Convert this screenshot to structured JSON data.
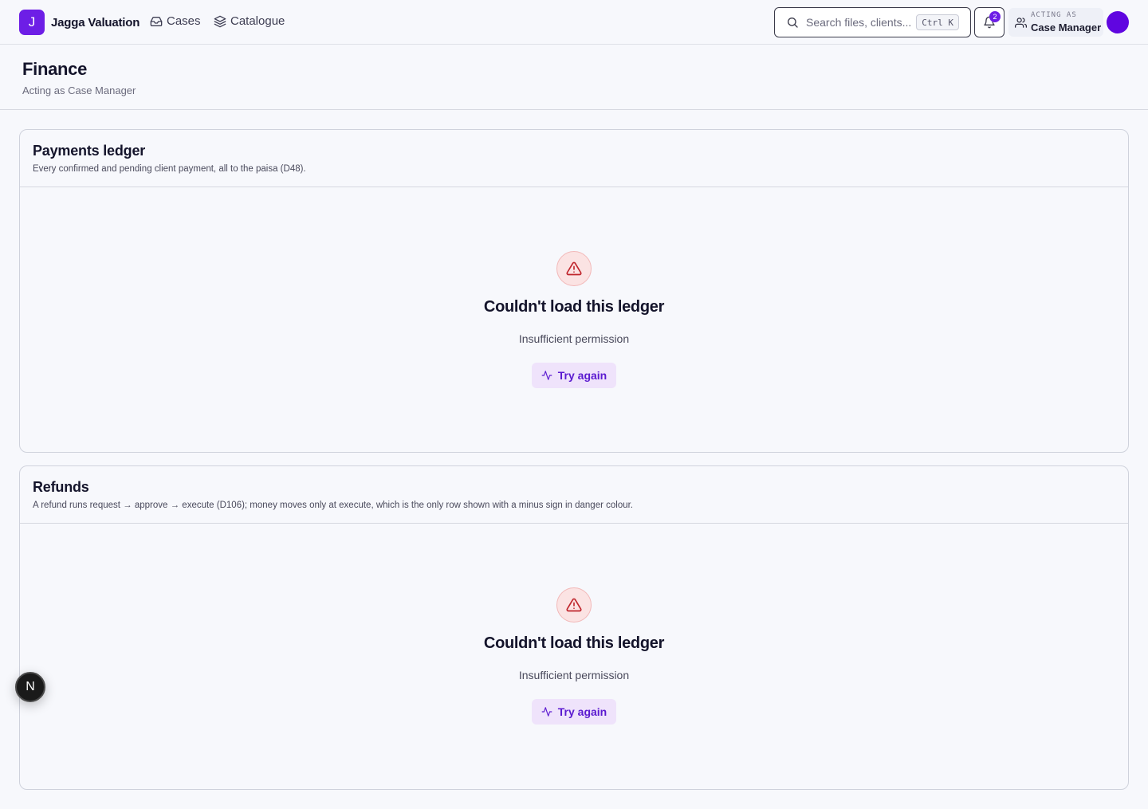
{
  "header": {
    "brand_initial": "J",
    "brand_name": "Jagga Valuation",
    "nav": [
      {
        "label": "Cases",
        "icon": "inbox-icon"
      },
      {
        "label": "Catalogue",
        "icon": "layers-icon"
      }
    ],
    "search": {
      "placeholder": "Search files, clients...",
      "shortcut": "Ctrl K"
    },
    "notifications": {
      "count": "2"
    },
    "acting": {
      "label": "ACTING AS",
      "role": "Case Manager"
    },
    "colors": {
      "accent": "#6d1ee6",
      "avatar": "#6006e0"
    }
  },
  "page": {
    "title": "Finance",
    "subtitle": "Acting as Case Manager"
  },
  "cards": [
    {
      "title": "Payments ledger",
      "description": "Every confirmed and pending client payment, all to the paisa (D48).",
      "error_title": "Couldn't load this ledger",
      "error_reason": "Insufficient permission",
      "retry_label": "Try again"
    },
    {
      "title": "Refunds",
      "description": "A refund runs request → approve → execute (D106); money moves only at execute, which is the only row shown with a minus sign in danger colour.",
      "error_title": "Couldn't load this ledger",
      "error_reason": "Insufficient permission",
      "retry_label": "Try again"
    }
  ],
  "dev_badge": {
    "letter": "N"
  }
}
